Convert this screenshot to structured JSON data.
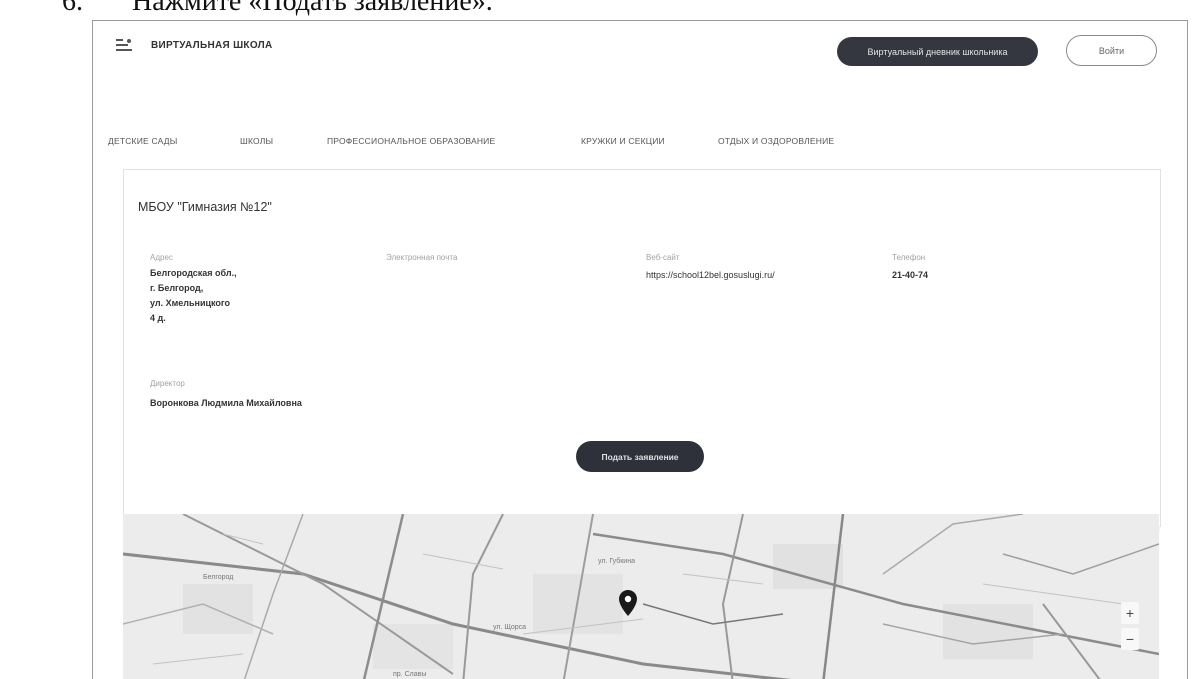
{
  "document": {
    "caption": "Нажмите «Подать заявление»."
  },
  "header": {
    "brand": "ВИРТУАЛЬНАЯ ШКОЛА",
    "primary_button": "Виртуальный дневник школьника",
    "login_button": "Войти"
  },
  "nav": {
    "items": [
      "ДЕТСКИЕ САДЫ",
      "ШКОЛЫ",
      "ПРОФЕССИОНАЛЬНОЕ ОБРАЗОВАНИЕ",
      "КРУЖКИ И СЕКЦИИ",
      "ОТДЫХ И ОЗДОРОВЛЕНИЕ"
    ]
  },
  "school": {
    "name": "МБОУ \"Гимназия №12\"",
    "address_label": "Адрес",
    "address_lines": [
      "Белгородская обл.,",
      "г. Белгород,",
      "ул. Хмельницкого",
      "4 д."
    ],
    "email_label": "Электронная почта",
    "website_label": "Веб-сайт",
    "website": "https://school12bel.gosuslugi.ru/",
    "phone_label": "Телефон",
    "phone": "21-40-74",
    "director_label": "Директор",
    "director": "Воронкова Людмила Михайловна",
    "apply_button": "Подать заявление"
  },
  "map": {
    "labels": [
      "Белгород",
      "ул. Губкина",
      "ул. Щорса",
      "пр. Славы"
    ],
    "zoom_in": "+",
    "zoom_out": "−"
  }
}
